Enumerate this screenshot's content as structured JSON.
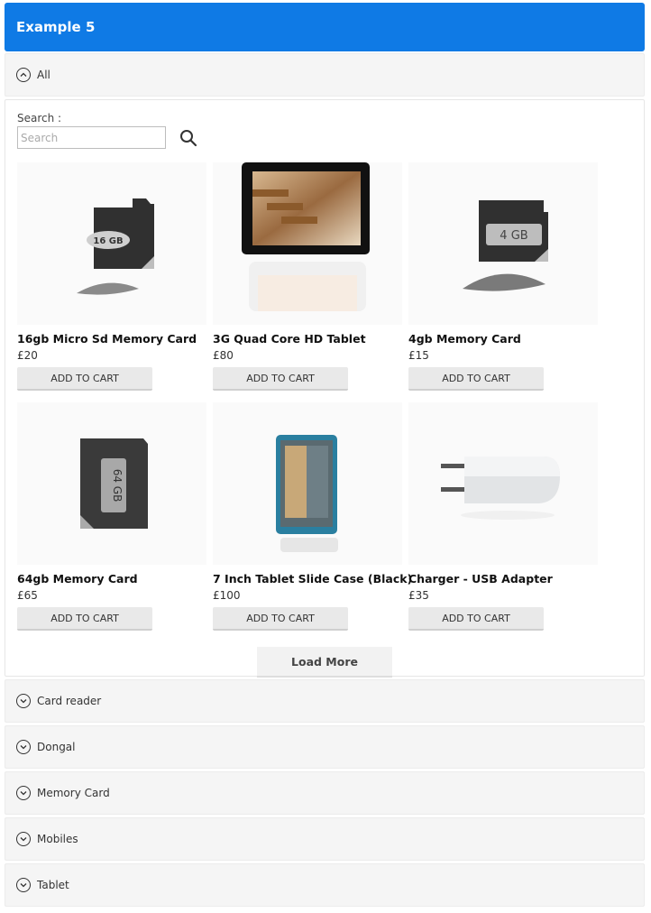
{
  "header": {
    "title": "Example 5"
  },
  "accordion_open": {
    "label": "All"
  },
  "search": {
    "label": "Search :",
    "placeholder": "Search"
  },
  "products": [
    {
      "name": "16gb Micro Sd Memory Card",
      "price": "£20",
      "cart_label": "ADD TO CART",
      "image_text": "16 GB"
    },
    {
      "name": "3G Quad Core HD Tablet",
      "price": "£80",
      "cart_label": "ADD TO CART"
    },
    {
      "name": "4gb Memory Card",
      "price": "£15",
      "cart_label": "ADD TO CART",
      "image_text": "4 GB"
    },
    {
      "name": "64gb Memory Card",
      "price": "£65",
      "cart_label": "ADD TO CART",
      "image_text": "64 GB"
    },
    {
      "name": "7 Inch Tablet Slide Case (Black)",
      "price": "£100",
      "cart_label": "ADD TO CART"
    },
    {
      "name": "Charger - USB Adapter",
      "price": "£35",
      "cart_label": "ADD TO CART"
    }
  ],
  "load_more": {
    "label": "Load More"
  },
  "categories": [
    {
      "label": "Card reader"
    },
    {
      "label": "Dongal"
    },
    {
      "label": "Memory Card"
    },
    {
      "label": "Mobiles"
    },
    {
      "label": "Tablet"
    }
  ],
  "colors": {
    "header_bg": "#0f7ae5",
    "row_bg": "#f5f5f5",
    "button_bg": "#e9e9e9"
  }
}
